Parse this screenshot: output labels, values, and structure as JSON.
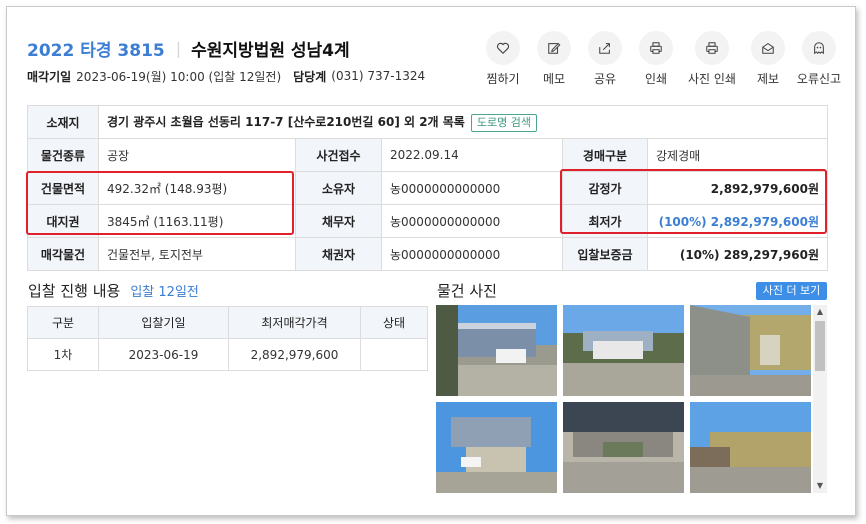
{
  "header": {
    "case_number": "2022 타경 3815",
    "court": "수원지방법원 성남4계",
    "sale_date_label": "매각기일",
    "sale_date_value": "2023-06-19(월) 10:00 (입찰 12일전)",
    "dept_label": "담당계",
    "dept_phone": "(031) 737-1324"
  },
  "actions": [
    {
      "label": "찜하기",
      "icon": "heart-icon"
    },
    {
      "label": "메모",
      "icon": "pencil-icon"
    },
    {
      "label": "공유",
      "icon": "share-icon"
    },
    {
      "label": "인쇄",
      "icon": "printer-icon"
    },
    {
      "label": "사진 인쇄",
      "icon": "printer-icon"
    },
    {
      "label": "제보",
      "icon": "envelope-icon"
    },
    {
      "label": "오류신고",
      "icon": "ghost-icon"
    }
  ],
  "info": {
    "address_label": "소재지",
    "address_value": "경기 광주시 초월읍 선동리 117-7 [산수로210번길 60] 외 2개 목록",
    "road_search_btn": "도로명 검색",
    "type_label": "물건종류",
    "type_value": "공장",
    "received_label": "사건접수",
    "received_value": "2022.09.14",
    "auction_type_label": "경매구분",
    "auction_type_value": "강제경매",
    "building_area_label": "건물면적",
    "building_area_value": "492.32㎡ (148.93평)",
    "owner_label": "소유자",
    "owner_value": "농0000000000000",
    "appraisal_label": "감정가",
    "appraisal_value": "2,892,979,600원",
    "land_right_label": "대지권",
    "land_right_value": "3845㎡ (1163.11평)",
    "debtor_label": "채무자",
    "debtor_value": "농0000000000000",
    "min_price_label": "최저가",
    "min_price_value": "(100%) 2,892,979,600원",
    "sale_item_label": "매각물건",
    "sale_item_value": "건물전부, 토지전부",
    "creditor_label": "채권자",
    "creditor_value": "농0000000000000",
    "deposit_label": "입찰보증금",
    "deposit_value": "(10%) 289,297,960원"
  },
  "bidding": {
    "title": "입찰 진행 내용",
    "note": "입찰 12일전",
    "headers": [
      "구분",
      "입찰기일",
      "최저매각가격",
      "상태"
    ],
    "rows": [
      {
        "round": "1차",
        "date": "2023-06-19",
        "price": "2,892,979,600",
        "status": ""
      }
    ]
  },
  "photos": {
    "title": "물건 사진",
    "more_btn": "사진 더 보기"
  },
  "colors": {
    "accent": "#3c7ed3",
    "highlight_box": "#e0202a",
    "header_cell_bg": "#f2f5fa",
    "more_button_bg": "#3c8ee6"
  }
}
